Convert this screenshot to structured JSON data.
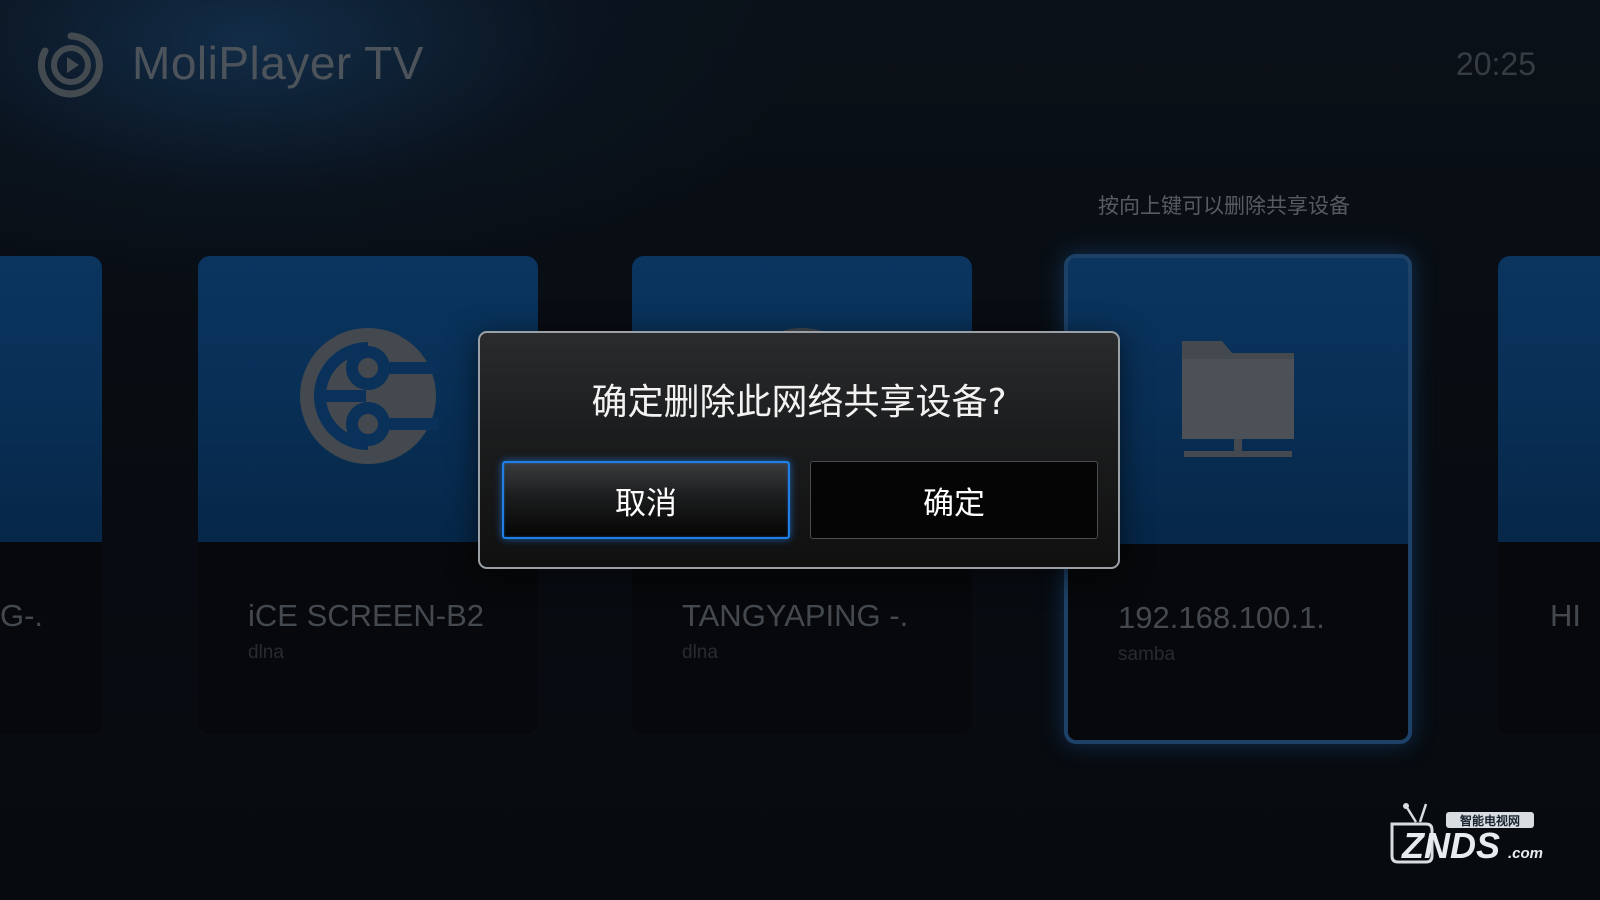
{
  "header": {
    "app_title": "MoliPlayer TV",
    "clock": "20:25"
  },
  "hint": "按向上键可以删除共享设备",
  "devices": [
    {
      "name": "G-.",
      "protocol": "",
      "icon": "partial-card"
    },
    {
      "name": "iCE SCREEN-B2",
      "protocol": "dlna",
      "icon": "dlna-link-icon"
    },
    {
      "name": "TANGYAPING -.",
      "protocol": "dlna",
      "icon": "dlna-link-icon"
    },
    {
      "name": "192.168.100.1.",
      "protocol": "samba",
      "icon": "network-folder-icon",
      "selected": true
    },
    {
      "name": "HI",
      "protocol": "",
      "icon": "partial-card"
    }
  ],
  "dialog": {
    "title": "确定删除此网络共享设备?",
    "cancel_label": "取消",
    "confirm_label": "确定",
    "focused": "cancel"
  },
  "watermark": {
    "brand": "ZNDS",
    "brand_suffix": ".com",
    "tagline": "智能电视网"
  },
  "colors": {
    "accent": "#1f7fe6",
    "card_art": "#0f4f90",
    "background": "#0d131c"
  }
}
